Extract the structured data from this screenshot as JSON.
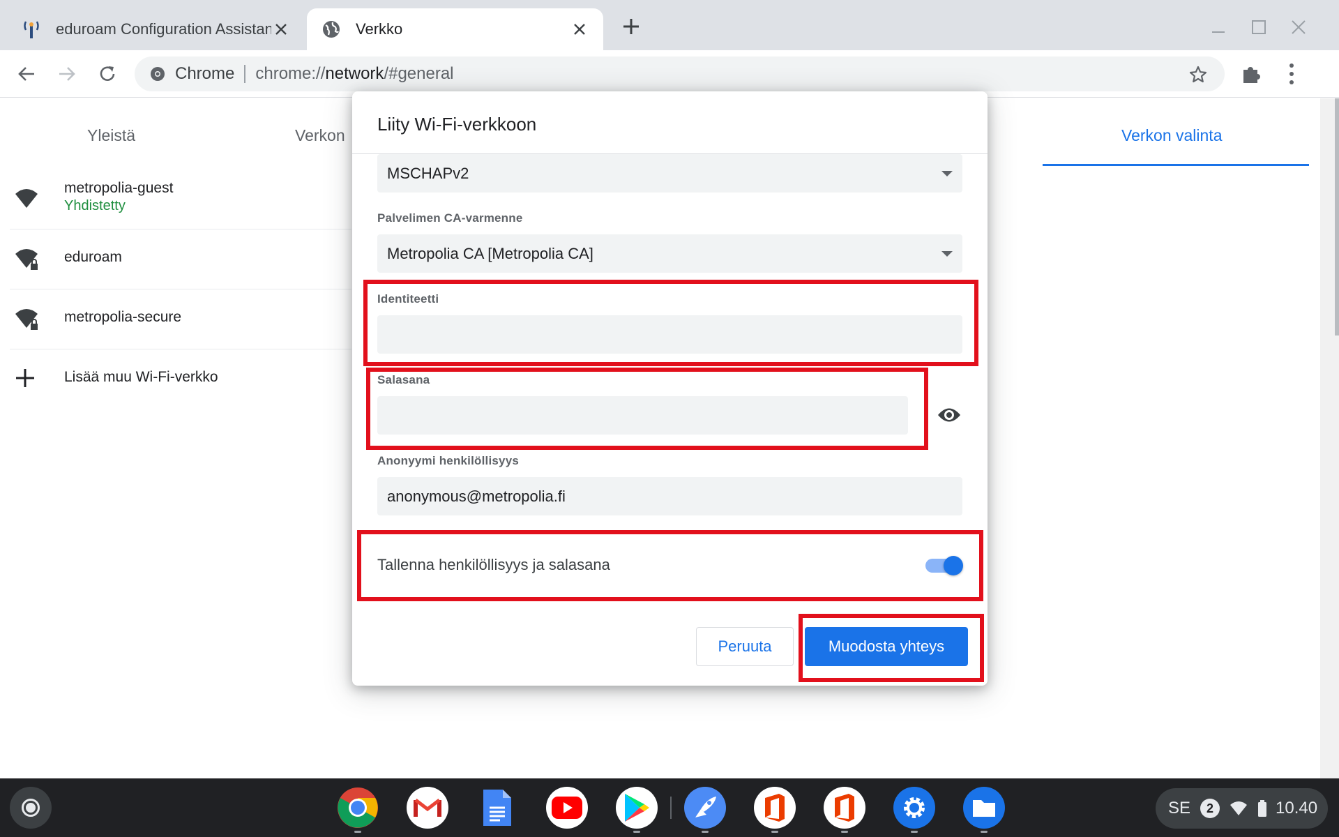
{
  "browser": {
    "tabs": [
      {
        "title": "eduroam Configuration Assistant Tool",
        "active": false
      },
      {
        "title": "Verkko",
        "active": true
      }
    ],
    "omnibox": {
      "chip_label": "Chrome",
      "url_scheme": "chrome://",
      "url_host": "network",
      "url_rest": "/#general"
    }
  },
  "page": {
    "tabs": [
      "Yleistä",
      "Verkon",
      "Verkon valinta"
    ],
    "networks": [
      {
        "name": "metropolia-guest",
        "status": "Yhdistetty",
        "icon": "wifi-icon"
      },
      {
        "name": "eduroam",
        "status": "",
        "icon": "wifi-lock-icon"
      },
      {
        "name": "metropolia-secure",
        "status": "",
        "icon": "wifi-lock-icon"
      }
    ],
    "add_network_label": "Lisää muu Wi-Fi-verkko"
  },
  "dialog": {
    "title": "Liity Wi-Fi-verkkoon",
    "eap_phase2": {
      "value": "MSCHAPv2"
    },
    "ca_cert": {
      "label": "Palvelimen CA-varmenne",
      "value": "Metropolia CA [Metropolia CA]"
    },
    "identity": {
      "label": "Identiteetti",
      "value": ""
    },
    "password": {
      "label": "Salasana",
      "value": ""
    },
    "anonymous_identity": {
      "label": "Anonyymi henkilöllisyys",
      "value": "anonymous@metropolia.fi"
    },
    "save_credentials": {
      "label": "Tallenna henkilöllisyys ja salasana",
      "checked": true
    },
    "cancel_label": "Peruuta",
    "connect_label": "Muodosta yhteys"
  },
  "shelf": {
    "apps": [
      "chrome-icon",
      "gmail-icon",
      "docs-icon",
      "youtube-icon",
      "play-store-icon",
      "app-rocket-icon",
      "office-icon",
      "office-icon",
      "settings-icon",
      "files-icon"
    ],
    "tray": {
      "ime": "SE",
      "notifications": "2",
      "time": "10.40"
    }
  },
  "colors": {
    "accent": "#1a73e8",
    "annotation": "#e2101c",
    "connected": "#1e8e3e"
  }
}
